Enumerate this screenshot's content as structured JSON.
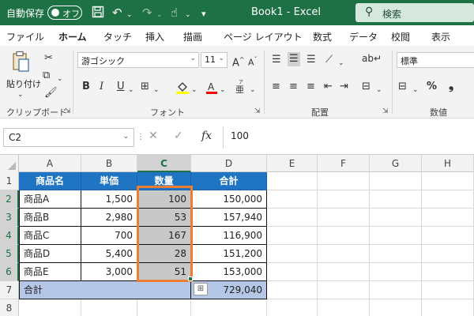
{
  "titlebar": {
    "autosave_label": "自動保存",
    "autosave_state": "オフ",
    "save_icon": "save-icon",
    "doc_title": "Book1  -  Excel",
    "search_label": "検索"
  },
  "tabs": [
    {
      "label": "ファイル",
      "active": false
    },
    {
      "label": "ホーム",
      "active": true
    },
    {
      "label": "タッチ",
      "active": false
    },
    {
      "label": "挿入",
      "active": false
    },
    {
      "label": "描画",
      "active": false
    },
    {
      "label": "ページ レイアウト",
      "active": false
    },
    {
      "label": "数式",
      "active": false
    },
    {
      "label": "データ",
      "active": false
    },
    {
      "label": "校閲",
      "active": false
    },
    {
      "label": "表示",
      "active": false
    }
  ],
  "ribbon": {
    "clipboard": {
      "label": "クリップボード",
      "paste_label": "貼り付け"
    },
    "font": {
      "label": "フォント",
      "font_name": "游ゴシック",
      "font_size": "11",
      "bold": "B",
      "italic": "I",
      "underline": "U"
    },
    "alignment": {
      "label": "配置"
    },
    "number": {
      "label": "数値",
      "format": "標準",
      "percent": "%"
    }
  },
  "formula_bar": {
    "name_box": "C2",
    "fx": "fx",
    "value": "100"
  },
  "sheet": {
    "columns": [
      "A",
      "B",
      "C",
      "D",
      "E",
      "F",
      "G",
      "H"
    ],
    "rows": [
      "1",
      "2",
      "3",
      "4",
      "5",
      "6",
      "7",
      "8"
    ],
    "header_row": [
      "商品名",
      "単価",
      "数量",
      "合計"
    ],
    "data_rows": [
      [
        "商品A",
        "1,500",
        "100",
        "150,000"
      ],
      [
        "商品B",
        "2,980",
        "53",
        "157,940"
      ],
      [
        "商品C",
        "700",
        "167",
        "116,900"
      ],
      [
        "商品D",
        "5,400",
        "28",
        "151,200"
      ],
      [
        "商品E",
        "3,000",
        "51",
        "153,000"
      ]
    ],
    "total_row": [
      "合計",
      "729,040"
    ],
    "selected_range": "C2:C6",
    "colors": {
      "header_fill": "#1f74c4",
      "total_fill": "#b4c7e7",
      "selection_fill": "#c8c8c8",
      "selection_border": "#ed7d31",
      "excel_green": "#1e7145"
    }
  }
}
